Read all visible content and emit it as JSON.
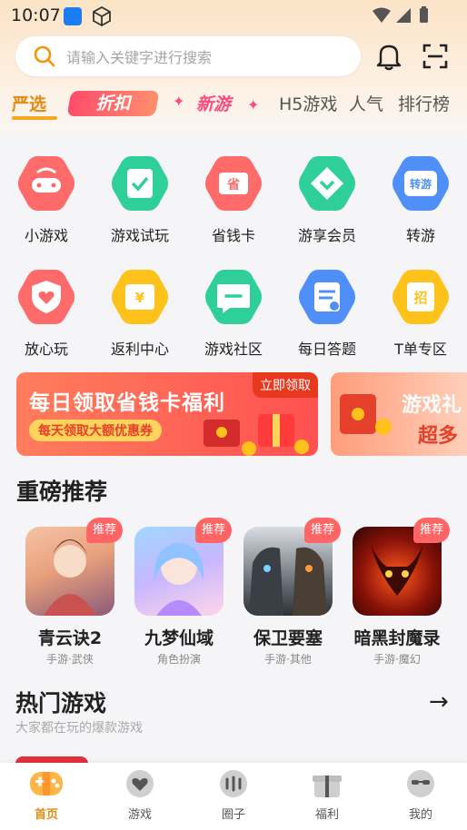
{
  "status": {
    "time": "10:07"
  },
  "search": {
    "placeholder": "请输入关键字进行搜索"
  },
  "tabs": [
    {
      "label": "严选"
    },
    {
      "label": "折扣"
    },
    {
      "label": "新游"
    },
    {
      "label": "H5游戏"
    },
    {
      "label": "人气"
    },
    {
      "label": "排行榜"
    }
  ],
  "grid": [
    {
      "label": "小游戏",
      "icon": "gamepad-icon",
      "color": "#ff6b6b"
    },
    {
      "label": "游戏试玩",
      "icon": "clipboard-check-icon",
      "color": "#2fcf9a"
    },
    {
      "label": "省钱卡",
      "icon": "wallet-card-icon",
      "color": "#ff6b6b"
    },
    {
      "label": "游享会员",
      "icon": "diamond-icon",
      "color": "#2fcf9a"
    },
    {
      "label": "转游",
      "icon": "transfer-icon",
      "color": "#4f8ff7"
    },
    {
      "label": "放心玩",
      "icon": "shield-heart-icon",
      "color": "#ff6b6b"
    },
    {
      "label": "返利中心",
      "icon": "coupon-yen-icon",
      "color": "#ffc21b"
    },
    {
      "label": "游戏社区",
      "icon": "chat-bubble-icon",
      "color": "#2fcf9a"
    },
    {
      "label": "每日答题",
      "icon": "quiz-doc-icon",
      "color": "#4f8ff7"
    },
    {
      "label": "T单专区",
      "icon": "recruit-icon",
      "color": "#ffc21b"
    }
  ],
  "banners": {
    "primary": {
      "title": "每日领取省钱卡福利",
      "subtitle": "每天领取大额优惠券",
      "badge": "立即领取"
    },
    "secondary": {
      "title": "游戏礼",
      "subtitle": "超多"
    }
  },
  "recommended": {
    "title": "重磅推荐",
    "items": [
      {
        "name": "青云诀2",
        "tag": "手游·武侠",
        "badge": "推荐"
      },
      {
        "name": "九梦仙域",
        "tag": "角色扮演",
        "badge": "推荐"
      },
      {
        "name": "保卫要塞",
        "tag": "手游·其他",
        "badge": "推荐"
      },
      {
        "name": "暗黑封魔录",
        "tag": "手游·魔幻",
        "badge": "推荐"
      }
    ]
  },
  "hot": {
    "title": "热门游戏",
    "subtitle": "大家都在玩的爆款游戏"
  },
  "nav": [
    {
      "label": "首页",
      "icon": "home-gamepad-icon",
      "active": true
    },
    {
      "label": "游戏",
      "icon": "game-heart-icon"
    },
    {
      "label": "圈子",
      "icon": "community-icon"
    },
    {
      "label": "福利",
      "icon": "gift-icon"
    },
    {
      "label": "我的",
      "icon": "profile-icon"
    }
  ],
  "colors": {
    "accent": "#e58a12",
    "badge": "#ff6565"
  }
}
